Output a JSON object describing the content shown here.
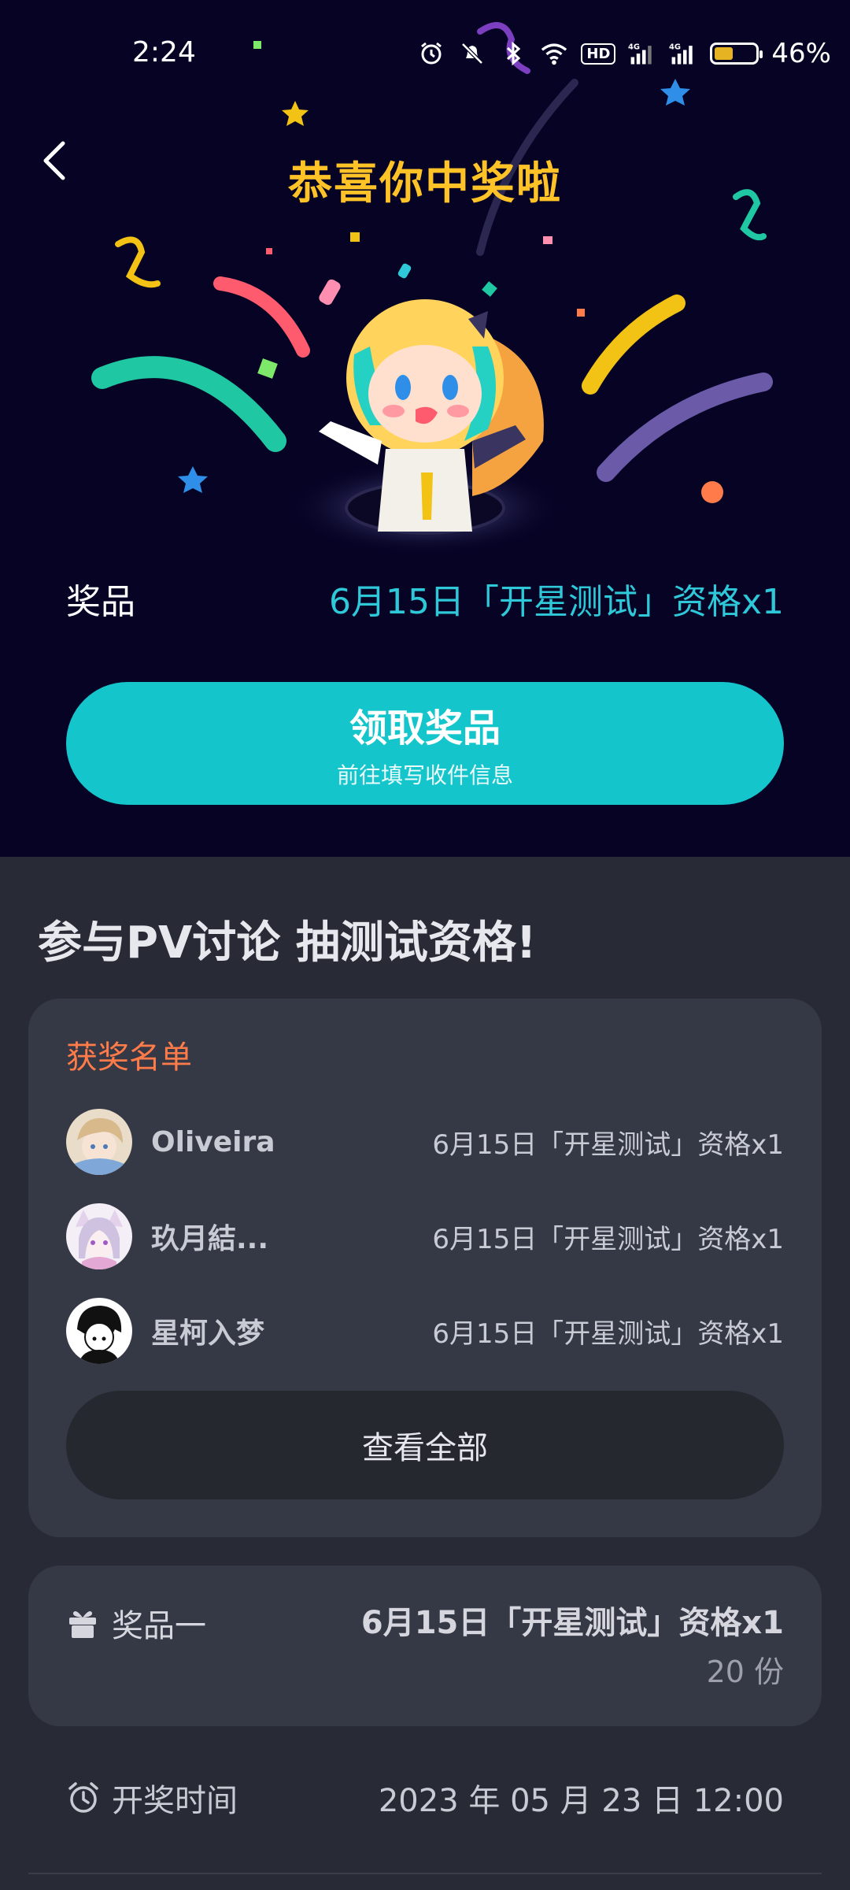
{
  "status_bar": {
    "time": "2:24",
    "battery_percent_text": "46%",
    "battery_level": 0.46,
    "network_badge": "HD",
    "signal_1": "4G",
    "signal_2": "4G",
    "icons": [
      "alarm-icon",
      "mute-icon",
      "bluetooth-icon",
      "wifi-icon",
      "hd-icon",
      "signal-icon",
      "signal-icon",
      "battery-icon"
    ]
  },
  "header": {
    "title": "恭喜你中奖啦",
    "back_icon": "back-arrow-icon"
  },
  "prize": {
    "label": "奖品",
    "value": "6月15日「开星测试」资格x1"
  },
  "claim_button": {
    "label": "领取奖品",
    "sublabel": "前往填写收件信息"
  },
  "section": {
    "title": "参与PV讨论 抽测试资格!"
  },
  "winners": {
    "title": "获奖名单",
    "items": [
      {
        "name": "Oliveira",
        "prize": "6月15日「开星测试」资格x1"
      },
      {
        "name": "玖月結...",
        "prize": "6月15日「开星测试」资格x1"
      },
      {
        "name": "星柯入梦",
        "prize": "6月15日「开星测试」资格x1"
      }
    ],
    "view_all_label": "查看全部"
  },
  "prize_card": {
    "label": "奖品一",
    "name": "6月15日「开星测试」资格x1",
    "count": "20 份",
    "icon": "gift-icon"
  },
  "draw": {
    "label": "开奖时间",
    "time": "2023 年 05 月 23 日 12:00",
    "icon": "alarm-clock-icon"
  },
  "colors": {
    "hero_bg": "#060325",
    "title": "#ffc227",
    "accent": "#14c5cb",
    "prize_text": "#2ec8d8",
    "winners_title": "#ff7b4a",
    "page_bg": "#282a35",
    "card_bg": "#353845"
  }
}
